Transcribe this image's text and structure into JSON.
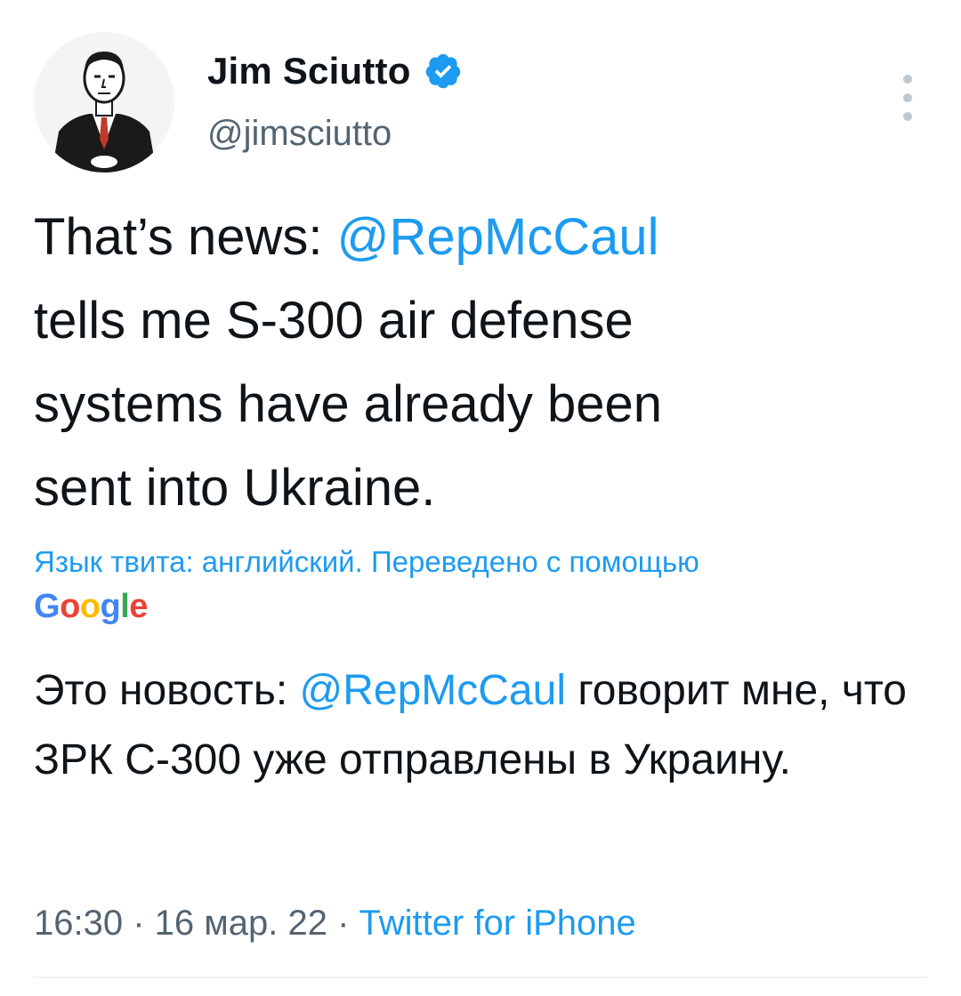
{
  "author": {
    "display_name": "Jim Sciutto",
    "handle": "@jimsciutto",
    "verified": true
  },
  "tweet": {
    "text_prefix": "That’s news: ",
    "mention": "@RepMcCaul",
    "text_suffix": "\ntells me S-300 air defense\nsystems have already been\nsent into Ukraine."
  },
  "translation": {
    "note": "Язык твита: английский. Переведено с помощью",
    "provider_letters": [
      "G",
      "o",
      "o",
      "g",
      "l",
      "e"
    ],
    "text_prefix": "Это новость: ",
    "mention": "@RepMcCaul",
    "text_suffix": " говорит мне, что ЗРК С-300 уже отправлены в Украину."
  },
  "meta": {
    "time": "16:30",
    "separator": " · ",
    "date": "16 мар. 22",
    "source": "Twitter for iPhone"
  },
  "colors": {
    "link": "#1d9bf0",
    "secondary_text": "#536471",
    "primary_text": "#0f1419",
    "verified_badge": "#1d9bf0"
  },
  "icons": {
    "verified": "verified-badge-icon",
    "more": "more-vertical-icon"
  }
}
